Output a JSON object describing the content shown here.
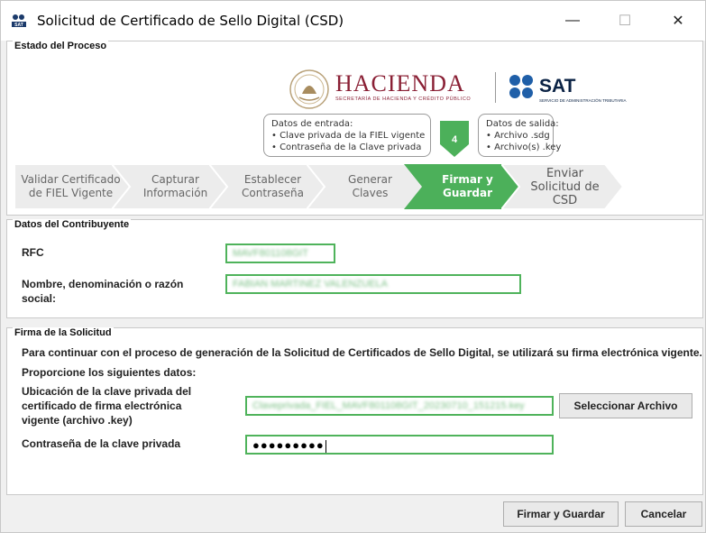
{
  "window": {
    "title": "Solicitud de Certificado de Sello Digital (CSD)",
    "minimize": "—",
    "maximize": "☐",
    "close": "✕"
  },
  "proceso": {
    "title": "Estado del Proceso",
    "hacienda_word": "HACIENDA",
    "hacienda_sub": "SECRETARÍA DE HACIENDA Y CRÉDITO PÚBLICO",
    "sat_word": "SAT",
    "sat_sub": "SERVICIO DE ADMINISTRACIÓN TRIBUTARIA",
    "input_box": {
      "title": "Datos de entrada:",
      "items": [
        "• Clave privada de la FIEL vigente",
        "• Contraseña de la Clave privada"
      ]
    },
    "output_box": {
      "title": "Datos de salida:",
      "items": [
        "• Archivo .sdg",
        "• Archivo(s) .key"
      ]
    },
    "step_number": "4",
    "steps": [
      {
        "line1": "Validar Certificado",
        "line2": "de FIEL Vigente",
        "line3": "",
        "state": "done"
      },
      {
        "line1": "Capturar",
        "line2": "Información",
        "line3": "",
        "state": "done"
      },
      {
        "line1": "Establecer",
        "line2": "Contraseña",
        "line3": "",
        "state": "done"
      },
      {
        "line1": "Generar",
        "line2": "Claves",
        "line3": "",
        "state": "done"
      },
      {
        "line1": "Firmar y",
        "line2": "Guardar",
        "line3": "",
        "state": "active"
      },
      {
        "line1": "Enviar",
        "line2": "Solicitud de",
        "line3": "CSD",
        "state": "next"
      }
    ],
    "colors": {
      "active": "#4cb05a",
      "inactive": "#ececec",
      "hacienda": "#8a2035",
      "sat": "#0a2244"
    }
  },
  "contribuyente": {
    "title": "Datos del Contribuyente",
    "rfc_label": "RFC",
    "rfc_value": "MAVF801108GIT",
    "nombre_label_1": "Nombre, denominación o razón",
    "nombre_label_2": "social:",
    "nombre_value": "FABIAN MARTINEZ VALENZUELA"
  },
  "firma": {
    "title": "Firma de la Solicitud",
    "intro": "Para continuar con el proceso de generación de la Solicitud de Certificados de Sello Digital, se utilizará su firma electrónica vigente.",
    "prompt": "Proporcione los siguientes datos:",
    "ubicacion_label_1": "Ubicación de la clave privada del",
    "ubicacion_label_2": "certificado de firma electrónica",
    "ubicacion_label_3": "vigente (archivo .key)",
    "ubicacion_value": "Claveprivada_FIEL_MAVF801108GIT_20230710_151215.key",
    "select_button": "Seleccionar Archivo",
    "password_label": "Contraseña de la clave privada",
    "password_value": "●●●●●●●●●"
  },
  "footer": {
    "sign_button": "Firmar y Guardar",
    "cancel_button": "Cancelar"
  }
}
